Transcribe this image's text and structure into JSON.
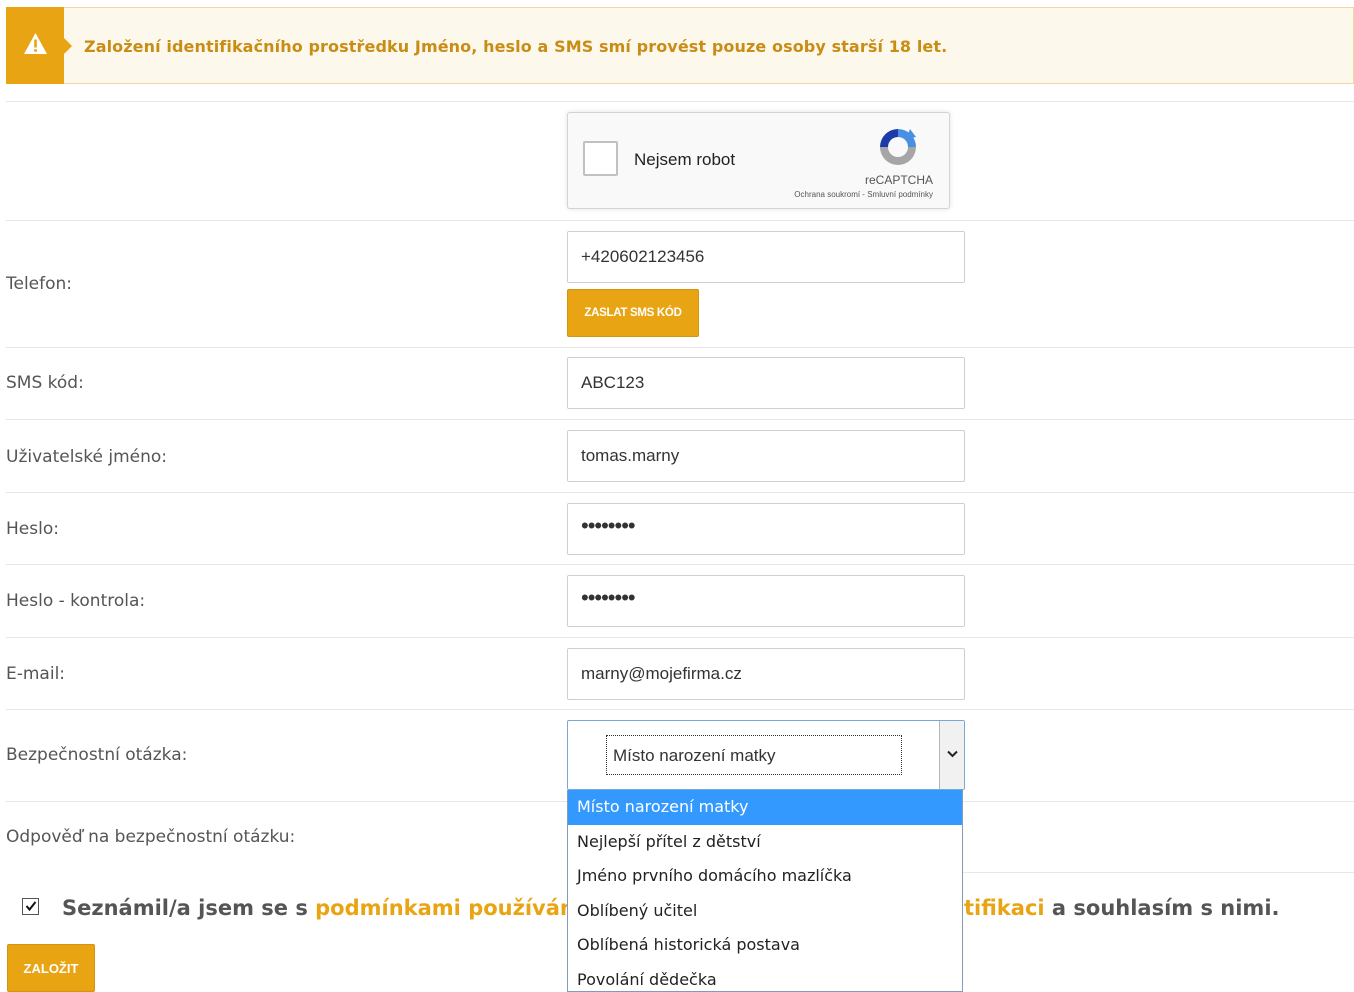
{
  "alert": {
    "text": "Založení identifikačního prostředku Jméno, heslo a SMS smí provést pouze osoby starší 18 let."
  },
  "captcha": {
    "label": "Nejsem robot",
    "brand": "reCAPTCHA",
    "links": "Ochrana soukromí - Smluvní podmínky"
  },
  "phone": {
    "label": "Telefon:",
    "value": "+420602123456",
    "send_button": "ZASLAT SMS KÓD"
  },
  "sms_code": {
    "label": "SMS kód:",
    "value": "ABC123"
  },
  "username": {
    "label": "Uživatelské jméno:",
    "value": "tomas.marny"
  },
  "password": {
    "label": "Heslo:",
    "value": "••••••••"
  },
  "password_check": {
    "label": "Heslo - kontrola:",
    "value": "••••••••"
  },
  "email": {
    "label": "E-mail:",
    "value": "marny@mojefirma.cz"
  },
  "security_question": {
    "label": "Bezpečnostní otázka:",
    "selected": "Místo narození matky",
    "options": [
      "Místo narození matky",
      "Nejlepší přítel z dětství",
      "Jméno prvního domácího mazlíčka",
      "Oblíbený učitel",
      "Oblíbená historická postava",
      "Povolání dědečka"
    ]
  },
  "security_answer": {
    "label": "Odpověď na bezpečnostní otázku:"
  },
  "consent": {
    "checked": true,
    "prefix": "Seznámil/a jsem se s",
    "link_start": "podmínkami používání",
    "link_end": "tifikaci",
    "suffix": "a souhlasím s nimi."
  },
  "submit": {
    "label": "ZALOŽIT"
  },
  "colors": {
    "accent": "#e8a412",
    "alert_text": "#c98d16",
    "selected_option": "#3399ff"
  }
}
